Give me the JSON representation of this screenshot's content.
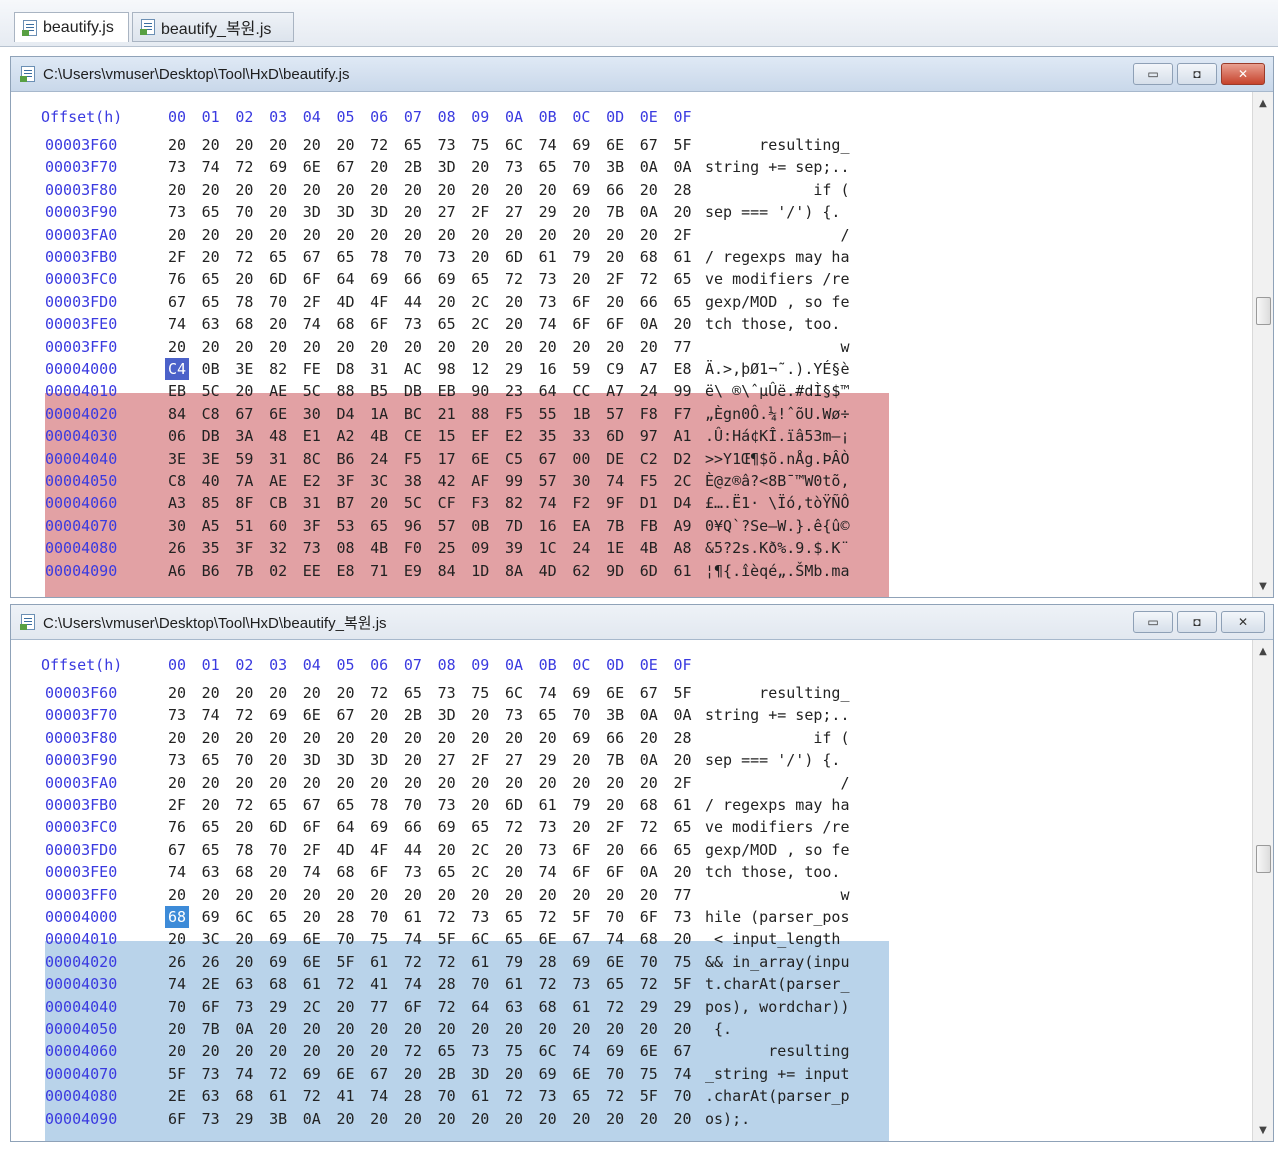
{
  "tabs": [
    {
      "label": "beautify.js",
      "active": true
    },
    {
      "label": "beautify_복원.js",
      "active": false
    }
  ],
  "header": {
    "offset": "Offset(h)",
    "columns": [
      "00",
      "01",
      "02",
      "03",
      "04",
      "05",
      "06",
      "07",
      "08",
      "09",
      "0A",
      "0B",
      "0C",
      "0D",
      "0E",
      "0F"
    ]
  },
  "colors": {
    "offset_text": "#3a3ae0",
    "changed_highlight": "#e2a1a4",
    "restored_highlight": "#b9d3ea",
    "close_button": "#c6432c"
  },
  "windows": [
    {
      "title": "C:\\Users\\vmuser\\Desktop\\Tool\\HxD\\beautify.js",
      "highlight": "changed",
      "rows": [
        {
          "off": "00003F60",
          "bytes": [
            "20",
            "20",
            "20",
            "20",
            "20",
            "20",
            "72",
            "65",
            "73",
            "75",
            "6C",
            "74",
            "69",
            "6E",
            "67",
            "5F"
          ],
          "text": "      resulting_"
        },
        {
          "off": "00003F70",
          "bytes": [
            "73",
            "74",
            "72",
            "69",
            "6E",
            "67",
            "20",
            "2B",
            "3D",
            "20",
            "73",
            "65",
            "70",
            "3B",
            "0A",
            "0A"
          ],
          "text": "string += sep;.."
        },
        {
          "off": "00003F80",
          "bytes": [
            "20",
            "20",
            "20",
            "20",
            "20",
            "20",
            "20",
            "20",
            "20",
            "20",
            "20",
            "20",
            "69",
            "66",
            "20",
            "28"
          ],
          "text": "            if ("
        },
        {
          "off": "00003F90",
          "bytes": [
            "73",
            "65",
            "70",
            "20",
            "3D",
            "3D",
            "3D",
            "20",
            "27",
            "2F",
            "27",
            "29",
            "20",
            "7B",
            "0A",
            "20"
          ],
          "text": "sep === '/') {. "
        },
        {
          "off": "00003FA0",
          "bytes": [
            "20",
            "20",
            "20",
            "20",
            "20",
            "20",
            "20",
            "20",
            "20",
            "20",
            "20",
            "20",
            "20",
            "20",
            "20",
            "2F"
          ],
          "text": "               /"
        },
        {
          "off": "00003FB0",
          "bytes": [
            "2F",
            "20",
            "72",
            "65",
            "67",
            "65",
            "78",
            "70",
            "73",
            "20",
            "6D",
            "61",
            "79",
            "20",
            "68",
            "61"
          ],
          "text": "/ regexps may ha"
        },
        {
          "off": "00003FC0",
          "bytes": [
            "76",
            "65",
            "20",
            "6D",
            "6F",
            "64",
            "69",
            "66",
            "69",
            "65",
            "72",
            "73",
            "20",
            "2F",
            "72",
            "65"
          ],
          "text": "ve modifiers /re"
        },
        {
          "off": "00003FD0",
          "bytes": [
            "67",
            "65",
            "78",
            "70",
            "2F",
            "4D",
            "4F",
            "44",
            "20",
            "2C",
            "20",
            "73",
            "6F",
            "20",
            "66",
            "65"
          ],
          "text": "gexp/MOD , so fe"
        },
        {
          "off": "00003FE0",
          "bytes": [
            "74",
            "63",
            "68",
            "20",
            "74",
            "68",
            "6F",
            "73",
            "65",
            "2C",
            "20",
            "74",
            "6F",
            "6F",
            "0A",
            "20"
          ],
          "text": "tch those, too. "
        },
        {
          "off": "00003FF0",
          "bytes": [
            "20",
            "20",
            "20",
            "20",
            "20",
            "20",
            "20",
            "20",
            "20",
            "20",
            "20",
            "20",
            "20",
            "20",
            "20",
            "77"
          ],
          "text": "               w"
        },
        {
          "off": "00004000",
          "bytes": [
            "C4",
            "0B",
            "3E",
            "82",
            "FE",
            "D8",
            "31",
            "AC",
            "98",
            "12",
            "29",
            "16",
            "59",
            "C9",
            "A7",
            "E8"
          ],
          "text": "Ä.>‚þØ1¬˜.).YÉ§è"
        },
        {
          "off": "00004010",
          "bytes": [
            "EB",
            "5C",
            "20",
            "AE",
            "5C",
            "88",
            "B5",
            "DB",
            "EB",
            "90",
            "23",
            "64",
            "CC",
            "A7",
            "24",
            "99"
          ],
          "text": "ë\\ ®\\ˆµÛë.#dÌ§$™"
        },
        {
          "off": "00004020",
          "bytes": [
            "84",
            "C8",
            "67",
            "6E",
            "30",
            "D4",
            "1A",
            "BC",
            "21",
            "88",
            "F5",
            "55",
            "1B",
            "57",
            "F8",
            "F7"
          ],
          "text": "„Ègn0Ô.¼!ˆõU.Wø÷"
        },
        {
          "off": "00004030",
          "bytes": [
            "06",
            "DB",
            "3A",
            "48",
            "E1",
            "A2",
            "4B",
            "CE",
            "15",
            "EF",
            "E2",
            "35",
            "33",
            "6D",
            "97",
            "A1"
          ],
          "text": ".Û:Há¢KÎ.ïâ53m—¡"
        },
        {
          "off": "00004040",
          "bytes": [
            "3E",
            "3E",
            "59",
            "31",
            "8C",
            "B6",
            "24",
            "F5",
            "17",
            "6E",
            "C5",
            "67",
            "00",
            "DE",
            "C2",
            "D2"
          ],
          "text": ">>Y1Œ¶$õ.nÅg.ÞÂÒ"
        },
        {
          "off": "00004050",
          "bytes": [
            "C8",
            "40",
            "7A",
            "AE",
            "E2",
            "3F",
            "3C",
            "38",
            "42",
            "AF",
            "99",
            "57",
            "30",
            "74",
            "F5",
            "2C"
          ],
          "text": "È@z®â?<8B¯™W0tõ,"
        },
        {
          "off": "00004060",
          "bytes": [
            "A3",
            "85",
            "8F",
            "CB",
            "31",
            "B7",
            "20",
            "5C",
            "CF",
            "F3",
            "82",
            "74",
            "F2",
            "9F",
            "D1",
            "D4"
          ],
          "text": "£….Ë1· \\Ïó‚tòŸÑÔ"
        },
        {
          "off": "00004070",
          "bytes": [
            "30",
            "A5",
            "51",
            "60",
            "3F",
            "53",
            "65",
            "96",
            "57",
            "0B",
            "7D",
            "16",
            "EA",
            "7B",
            "FB",
            "A9"
          ],
          "text": "0¥Q`?Se–W.}.ê{û©"
        },
        {
          "off": "00004080",
          "bytes": [
            "26",
            "35",
            "3F",
            "32",
            "73",
            "08",
            "4B",
            "F0",
            "25",
            "09",
            "39",
            "1C",
            "24",
            "1E",
            "4B",
            "A8"
          ],
          "text": "&5?2s.Kð%.9.$.K¨"
        },
        {
          "off": "00004090",
          "bytes": [
            "A6",
            "B6",
            "7B",
            "02",
            "EE",
            "E8",
            "71",
            "E9",
            "84",
            "1D",
            "8A",
            "4D",
            "62",
            "9D",
            "6D",
            "61"
          ],
          "text": "¦¶{.îèqé„.ŠMb.ma"
        }
      ]
    },
    {
      "title": "C:\\Users\\vmuser\\Desktop\\Tool\\HxD\\beautify_복원.js",
      "highlight": "restored",
      "rows": [
        {
          "off": "00003F60",
          "bytes": [
            "20",
            "20",
            "20",
            "20",
            "20",
            "20",
            "72",
            "65",
            "73",
            "75",
            "6C",
            "74",
            "69",
            "6E",
            "67",
            "5F"
          ],
          "text": "      resulting_"
        },
        {
          "off": "00003F70",
          "bytes": [
            "73",
            "74",
            "72",
            "69",
            "6E",
            "67",
            "20",
            "2B",
            "3D",
            "20",
            "73",
            "65",
            "70",
            "3B",
            "0A",
            "0A"
          ],
          "text": "string += sep;.."
        },
        {
          "off": "00003F80",
          "bytes": [
            "20",
            "20",
            "20",
            "20",
            "20",
            "20",
            "20",
            "20",
            "20",
            "20",
            "20",
            "20",
            "69",
            "66",
            "20",
            "28"
          ],
          "text": "            if ("
        },
        {
          "off": "00003F90",
          "bytes": [
            "73",
            "65",
            "70",
            "20",
            "3D",
            "3D",
            "3D",
            "20",
            "27",
            "2F",
            "27",
            "29",
            "20",
            "7B",
            "0A",
            "20"
          ],
          "text": "sep === '/') {. "
        },
        {
          "off": "00003FA0",
          "bytes": [
            "20",
            "20",
            "20",
            "20",
            "20",
            "20",
            "20",
            "20",
            "20",
            "20",
            "20",
            "20",
            "20",
            "20",
            "20",
            "2F"
          ],
          "text": "               /"
        },
        {
          "off": "00003FB0",
          "bytes": [
            "2F",
            "20",
            "72",
            "65",
            "67",
            "65",
            "78",
            "70",
            "73",
            "20",
            "6D",
            "61",
            "79",
            "20",
            "68",
            "61"
          ],
          "text": "/ regexps may ha"
        },
        {
          "off": "00003FC0",
          "bytes": [
            "76",
            "65",
            "20",
            "6D",
            "6F",
            "64",
            "69",
            "66",
            "69",
            "65",
            "72",
            "73",
            "20",
            "2F",
            "72",
            "65"
          ],
          "text": "ve modifiers /re"
        },
        {
          "off": "00003FD0",
          "bytes": [
            "67",
            "65",
            "78",
            "70",
            "2F",
            "4D",
            "4F",
            "44",
            "20",
            "2C",
            "20",
            "73",
            "6F",
            "20",
            "66",
            "65"
          ],
          "text": "gexp/MOD , so fe"
        },
        {
          "off": "00003FE0",
          "bytes": [
            "74",
            "63",
            "68",
            "20",
            "74",
            "68",
            "6F",
            "73",
            "65",
            "2C",
            "20",
            "74",
            "6F",
            "6F",
            "0A",
            "20"
          ],
          "text": "tch those, too. "
        },
        {
          "off": "00003FF0",
          "bytes": [
            "20",
            "20",
            "20",
            "20",
            "20",
            "20",
            "20",
            "20",
            "20",
            "20",
            "20",
            "20",
            "20",
            "20",
            "20",
            "77"
          ],
          "text": "               w"
        },
        {
          "off": "00004000",
          "bytes": [
            "68",
            "69",
            "6C",
            "65",
            "20",
            "28",
            "70",
            "61",
            "72",
            "73",
            "65",
            "72",
            "5F",
            "70",
            "6F",
            "73"
          ],
          "text": "hile (parser_pos"
        },
        {
          "off": "00004010",
          "bytes": [
            "20",
            "3C",
            "20",
            "69",
            "6E",
            "70",
            "75",
            "74",
            "5F",
            "6C",
            "65",
            "6E",
            "67",
            "74",
            "68",
            "20"
          ],
          "text": " < input_length "
        },
        {
          "off": "00004020",
          "bytes": [
            "26",
            "26",
            "20",
            "69",
            "6E",
            "5F",
            "61",
            "72",
            "72",
            "61",
            "79",
            "28",
            "69",
            "6E",
            "70",
            "75"
          ],
          "text": "&& in_array(inpu"
        },
        {
          "off": "00004030",
          "bytes": [
            "74",
            "2E",
            "63",
            "68",
            "61",
            "72",
            "41",
            "74",
            "28",
            "70",
            "61",
            "72",
            "73",
            "65",
            "72",
            "5F"
          ],
          "text": "t.charAt(parser_"
        },
        {
          "off": "00004040",
          "bytes": [
            "70",
            "6F",
            "73",
            "29",
            "2C",
            "20",
            "77",
            "6F",
            "72",
            "64",
            "63",
            "68",
            "61",
            "72",
            "29",
            "29"
          ],
          "text": "pos), wordchar))"
        },
        {
          "off": "00004050",
          "bytes": [
            "20",
            "7B",
            "0A",
            "20",
            "20",
            "20",
            "20",
            "20",
            "20",
            "20",
            "20",
            "20",
            "20",
            "20",
            "20",
            "20"
          ],
          "text": " {.             "
        },
        {
          "off": "00004060",
          "bytes": [
            "20",
            "20",
            "20",
            "20",
            "20",
            "20",
            "20",
            "72",
            "65",
            "73",
            "75",
            "6C",
            "74",
            "69",
            "6E",
            "67"
          ],
          "text": "       resulting"
        },
        {
          "off": "00004070",
          "bytes": [
            "5F",
            "73",
            "74",
            "72",
            "69",
            "6E",
            "67",
            "20",
            "2B",
            "3D",
            "20",
            "69",
            "6E",
            "70",
            "75",
            "74"
          ],
          "text": "_string += input"
        },
        {
          "off": "00004080",
          "bytes": [
            "2E",
            "63",
            "68",
            "61",
            "72",
            "41",
            "74",
            "28",
            "70",
            "61",
            "72",
            "73",
            "65",
            "72",
            "5F",
            "70"
          ],
          "text": ".charAt(parser_p"
        },
        {
          "off": "00004090",
          "bytes": [
            "6F",
            "73",
            "29",
            "3B",
            "0A",
            "20",
            "20",
            "20",
            "20",
            "20",
            "20",
            "20",
            "20",
            "20",
            "20",
            "20"
          ],
          "text": "os);.           "
        }
      ]
    }
  ]
}
